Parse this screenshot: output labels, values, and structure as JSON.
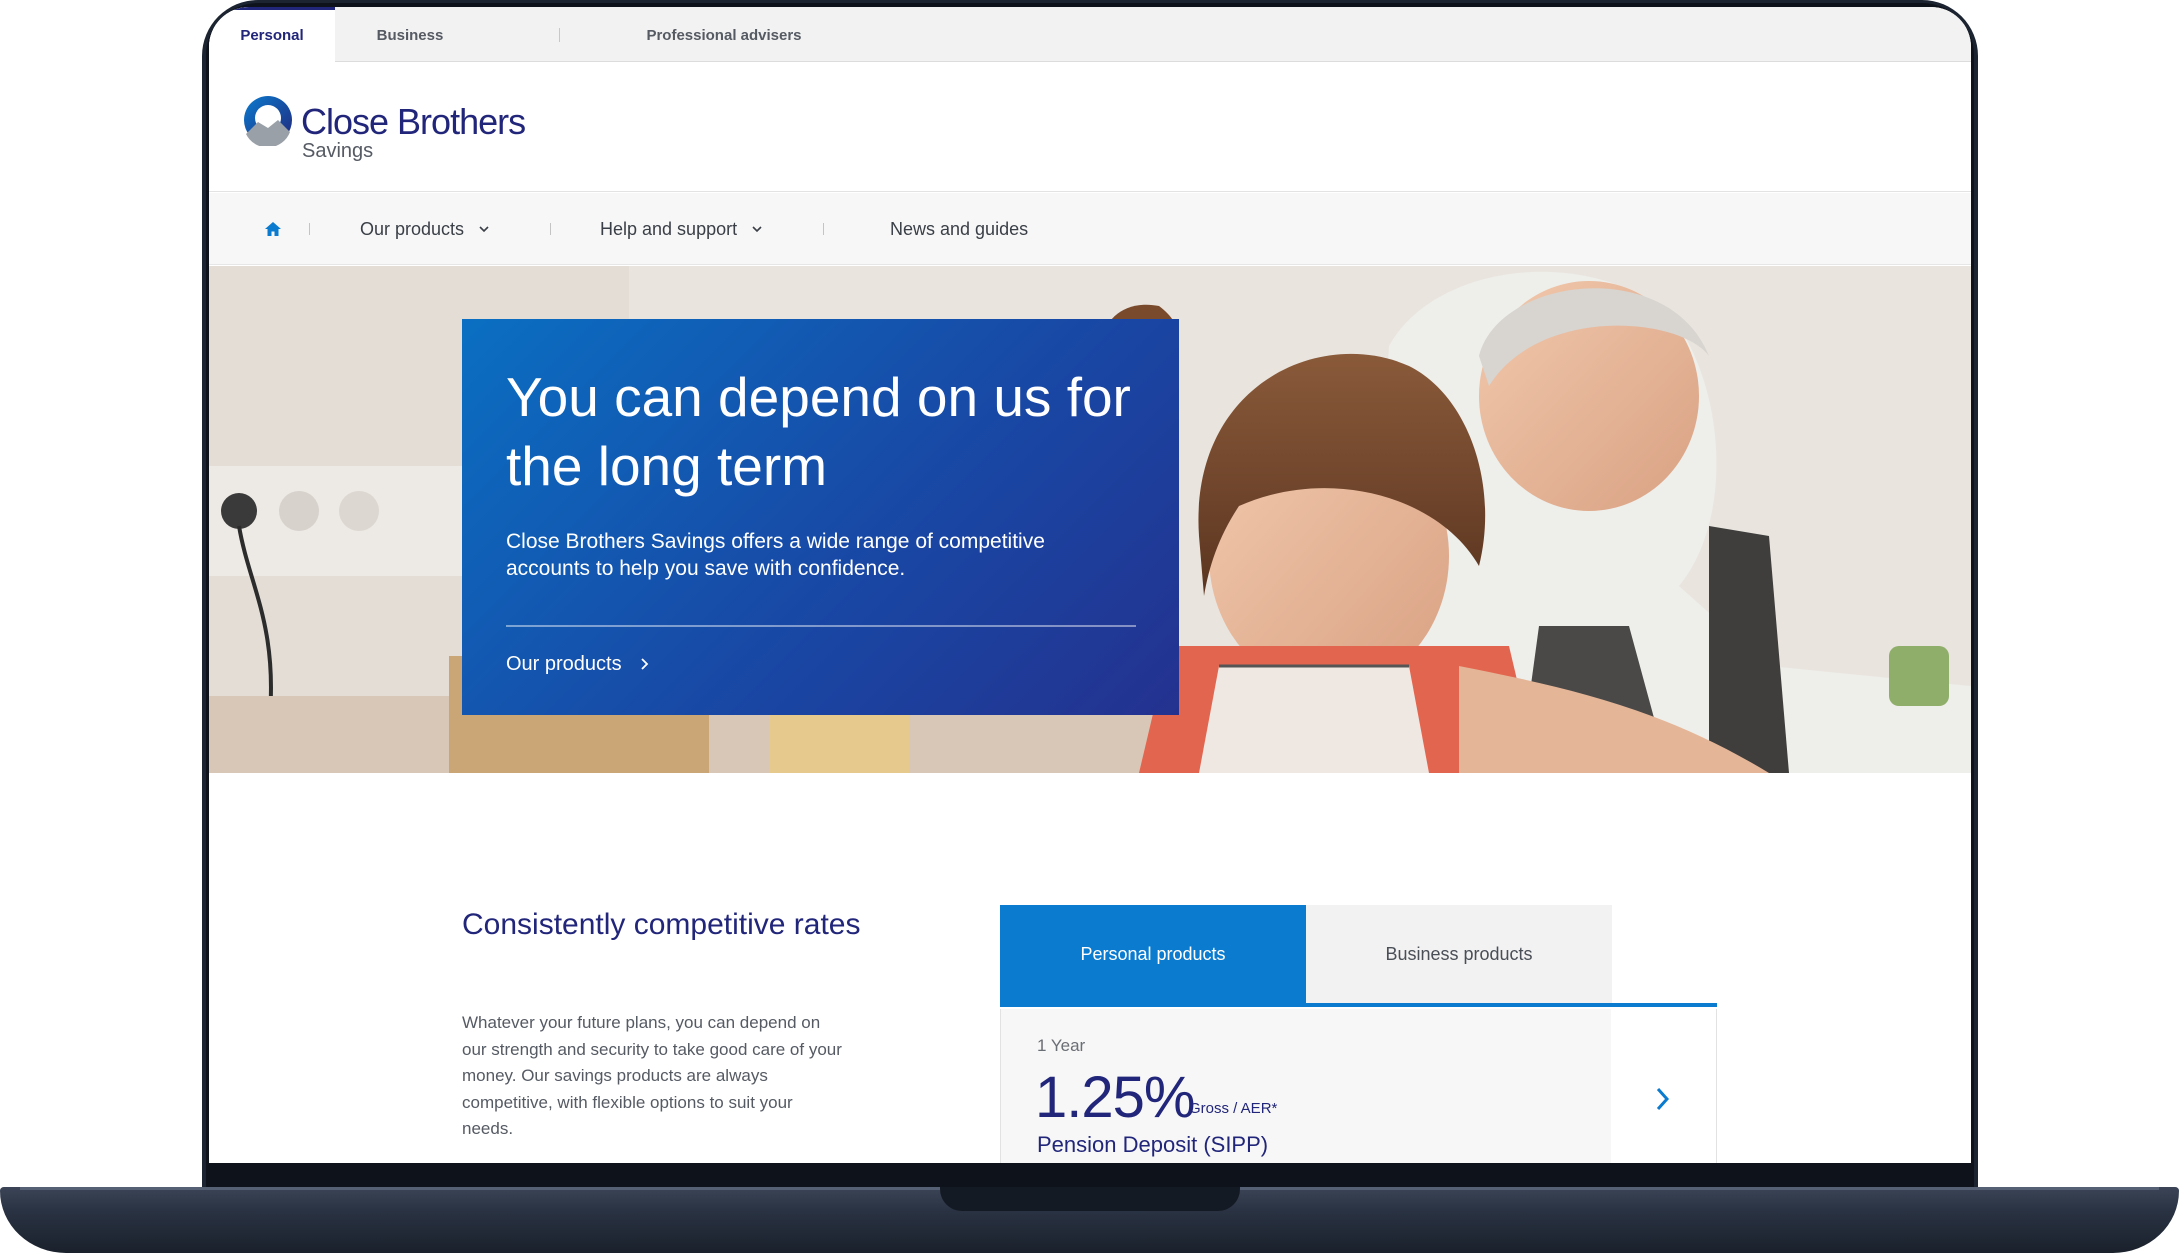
{
  "top_tabs": {
    "personal": "Personal",
    "business": "Business",
    "professional": "Professional advisers"
  },
  "logo": {
    "name": "Close Brothers",
    "sub": "Savings"
  },
  "nav": {
    "home_icon": "home-icon",
    "our_products": "Our products",
    "help_support": "Help and support",
    "news_guides": "News and guides"
  },
  "hero": {
    "title": "You can depend on us for the long term",
    "text": "Close Brothers Savings offers a wide range of competitive accounts to help you save with confidence.",
    "link": "Our products"
  },
  "rates": {
    "heading": "Consistently competitive rates",
    "text": "Whatever your future plans, you can depend on our strength and security to take good care of your money. Our savings products are always competitive, with flexible options to suit your needs."
  },
  "product_tabs": {
    "personal": "Personal products",
    "business": "Business products"
  },
  "rate_card": {
    "term": "1 Year",
    "value": "1.25%",
    "basis": "Gross / AER*",
    "name": "Pension Deposit (SIPP)"
  },
  "colors": {
    "brand_navy": "#22267a",
    "brand_blue": "#0a7bcf",
    "hero_gradient_start": "#0a6fc2",
    "hero_gradient_end": "#24318f"
  }
}
